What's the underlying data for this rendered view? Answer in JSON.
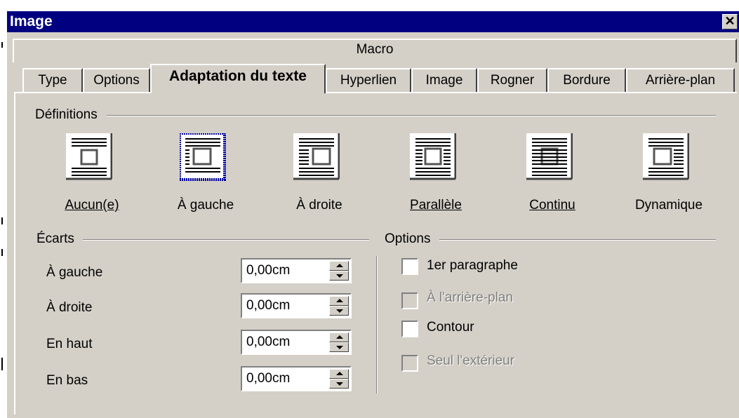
{
  "window": {
    "title": "Image",
    "close_glyph": "✕"
  },
  "tabs": {
    "row1": [
      "Macro"
    ],
    "row2": [
      "Type",
      "Options",
      "Adaptation du texte",
      "Hyperlien",
      "Image",
      "Rogner",
      "Bordure",
      "Arrière-plan"
    ],
    "active": "Adaptation du texte"
  },
  "definitions": {
    "group_label": "Définitions",
    "options": [
      {
        "label": "Aucun(e)",
        "icon": "wrap-none-icon",
        "selected": false
      },
      {
        "label": "À gauche",
        "icon": "wrap-left-icon",
        "selected": true
      },
      {
        "label": "À droite",
        "icon": "wrap-right-icon",
        "selected": false
      },
      {
        "label": "Parallèle",
        "icon": "wrap-parallel-icon",
        "selected": false
      },
      {
        "label": "Continu",
        "icon": "wrap-through-icon",
        "selected": false
      },
      {
        "label": "Dynamique",
        "icon": "wrap-optimal-icon",
        "selected": false
      }
    ]
  },
  "spacing": {
    "group_label": "Écarts",
    "fields": [
      {
        "label": "À gauche",
        "value": "0,00cm"
      },
      {
        "label": "À droite",
        "value": "0,00cm"
      },
      {
        "label": "En haut",
        "value": "0,00cm"
      },
      {
        "label": "En bas",
        "value": "0,00cm"
      }
    ]
  },
  "options": {
    "group_label": "Options",
    "checkboxes": [
      {
        "label": "1er paragraphe",
        "checked": false,
        "enabled": true
      },
      {
        "label": "À l'arrière-plan",
        "checked": false,
        "enabled": false
      },
      {
        "label": "Contour",
        "checked": false,
        "enabled": true
      },
      {
        "label": "Seul l'extérieur",
        "checked": false,
        "enabled": false
      }
    ]
  },
  "colors": {
    "titlebar": "#000080",
    "dialog_bg": "#d4d0c8",
    "disabled_text": "#808080",
    "focus_border": "#0000a0"
  }
}
